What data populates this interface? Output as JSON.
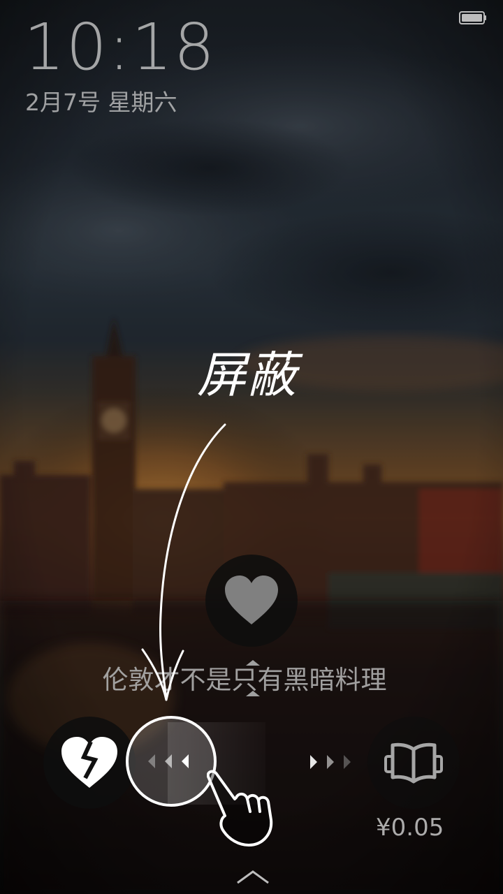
{
  "status_bar": {
    "battery_icon": "battery-icon"
  },
  "lockscreen": {
    "time": "10:18",
    "date": "2月7号 星期六"
  },
  "wallpaper": {
    "caption": "伦敦才不是只有黑暗料理"
  },
  "annotation": {
    "text": "屏蔽",
    "icons": [
      "annotation-arrow",
      "hand-pointer-icon"
    ]
  },
  "actions": {
    "like_icon": "heart-icon",
    "dislike_icon": "broken-heart-icon",
    "read_icon": "open-book-icon",
    "slider_left_icon": "chevrons-left-icon",
    "slider_right_icon": "chevrons-right-icon",
    "price": "¥0.05",
    "swipe_up_icon": "chevron-up-icon"
  },
  "colors": {
    "button_bg": "#0e0e0e",
    "annotation": "#ffffff",
    "text_dim": "#cdcdcd"
  }
}
